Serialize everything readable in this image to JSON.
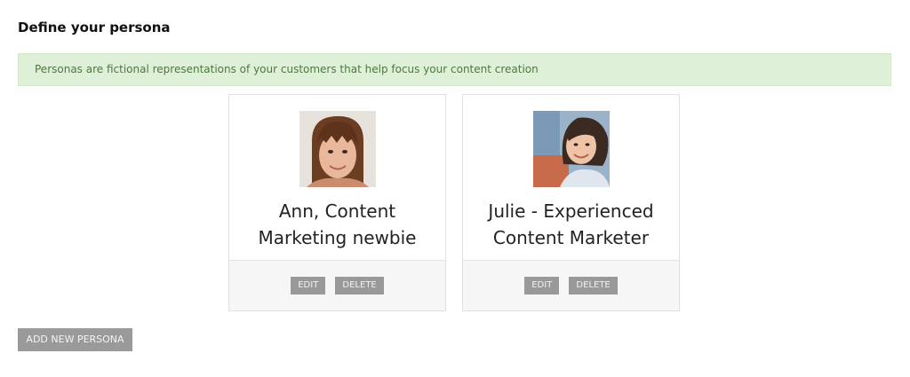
{
  "page": {
    "title": "Define your persona",
    "info_message": "Personas are fictional representations of your customers that help focus your content creation"
  },
  "personas": [
    {
      "name": "Ann, Content Marketing newbie",
      "edit_label": "EDIT",
      "delete_label": "DELETE"
    },
    {
      "name": "Julie - Experienced Content Marketer",
      "edit_label": "EDIT",
      "delete_label": "DELETE"
    }
  ],
  "actions": {
    "add_label": "ADD NEW PERSONA"
  },
  "colors": {
    "banner_bg": "#dff0d8",
    "banner_text": "#4a7a3b",
    "button_bg": "#999999"
  }
}
